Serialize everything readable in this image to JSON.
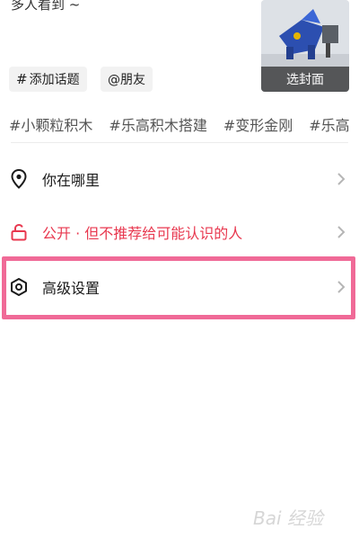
{
  "caption": "多人看到 ~",
  "cover": {
    "button_label": "选封面"
  },
  "chips": {
    "topic_label": "添加话题",
    "topic_icon": "hash-icon",
    "friend_label": "@朋友"
  },
  "tags": [
    "#小颗粒积木",
    "#乐高积木搭建",
    "#变形金刚",
    "#乐高"
  ],
  "settings": {
    "where": {
      "label": "你在哪里",
      "icon": "location-pin-icon"
    },
    "privacy": {
      "label": "公开 · 但不推荐给可能认识的人",
      "icon": "unlock-icon",
      "color": "#e8384f"
    },
    "advanced": {
      "label": "高级设置",
      "icon": "hexagon-settings-icon"
    }
  },
  "highlight_color": "#f06a97",
  "watermark": "Bai 经验"
}
